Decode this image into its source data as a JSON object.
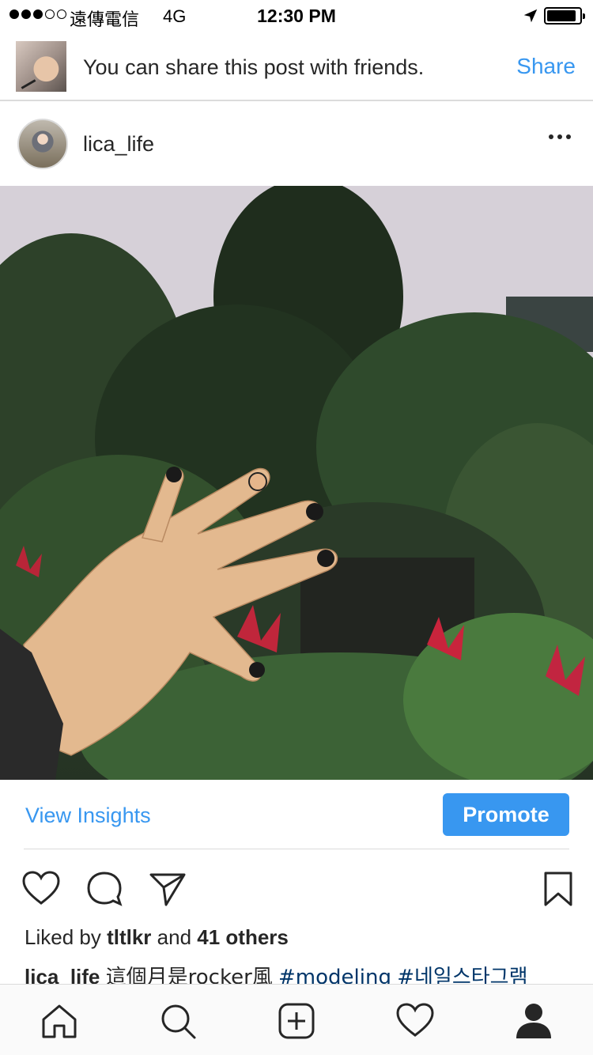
{
  "status_bar": {
    "carrier": "遠傳電信",
    "network": "4G",
    "time": "12:30 PM",
    "signal_bars_filled": 3,
    "signal_bars_total": 5
  },
  "share_banner": {
    "message": "You can share this post with friends.",
    "action": "Share"
  },
  "post": {
    "username": "lica_life",
    "more_icon": "more-horizontal-icon"
  },
  "insights": {
    "view_label": "View Insights",
    "promote_label": "Promote"
  },
  "actions": {
    "icons": [
      "heart-icon",
      "comment-icon",
      "send-icon",
      "bookmark-icon"
    ]
  },
  "likes": {
    "prefix": "Liked by",
    "user": "tltlkr",
    "conjunction": "and",
    "others": "41 others"
  },
  "caption": {
    "username": "lica_life",
    "text": "這個月是rocker風",
    "hashtags": [
      "#modeling",
      "#네일스타그램"
    ]
  },
  "tab_bar": {
    "items": [
      "home-icon",
      "search-icon",
      "add-icon",
      "activity-icon",
      "profile-icon"
    ]
  },
  "colors": {
    "accent": "#3897f0",
    "text": "#262626",
    "hashtag": "#003569",
    "divider": "#dbdbdb"
  }
}
